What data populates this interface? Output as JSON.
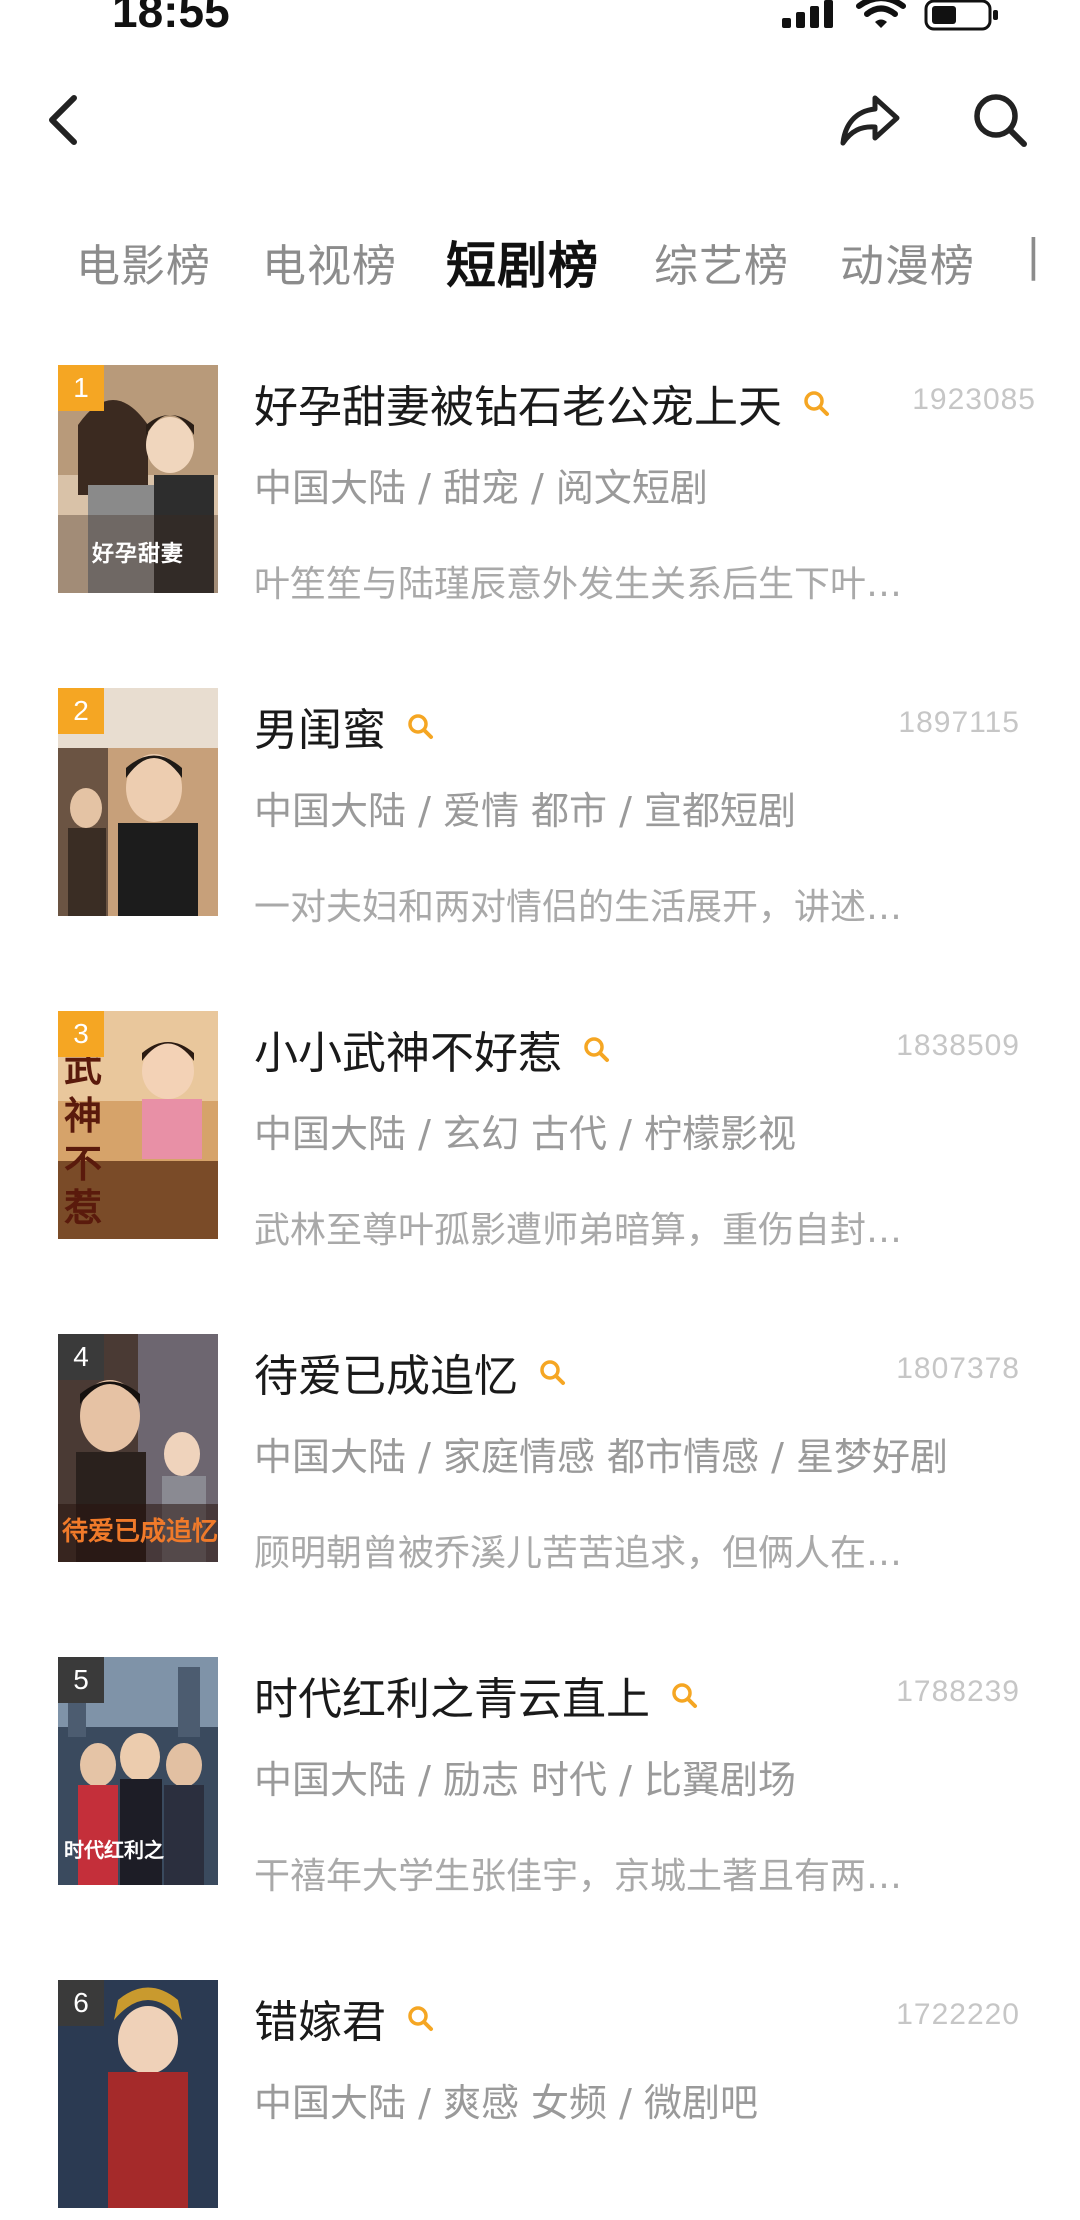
{
  "status_bar": {
    "time": "18:55"
  },
  "nav": {
    "back_icon": "chevron-left-icon",
    "share_icon": "share-arrow-icon",
    "search_icon": "search-icon"
  },
  "tabs": [
    {
      "label": "电影榜",
      "active": false
    },
    {
      "label": "电视榜",
      "active": false
    },
    {
      "label": "短剧榜",
      "active": true
    },
    {
      "label": "综艺榜",
      "active": false
    },
    {
      "label": "动漫榜",
      "active": false
    }
  ],
  "colors": {
    "accent": "#f5a623",
    "badge_top": "#f5a623",
    "badge_other": "#3a3a3a",
    "score": "#c6c6c6",
    "meta": "#9a9a9a"
  },
  "items": [
    {
      "rank": "1",
      "title": "好孕甜妻被钻石老公宠上天",
      "score": "1923085",
      "meta": "中国大陆 / 甜宠 / 阅文短剧",
      "desc": "叶笙笙与陆瑾辰意外发生关系后生下叶…"
    },
    {
      "rank": "2",
      "title": "男闺蜜",
      "score": "1897115",
      "meta": "中国大陆 / 爱情 都市 / 宣都短剧",
      "desc": "一对夫妇和两对情侣的生活展开，讲述…"
    },
    {
      "rank": "3",
      "title": "小小武神不好惹",
      "score": "1838509",
      "meta": "中国大陆 / 玄幻 古代 / 柠檬影视",
      "desc": "武林至尊叶孤影遭师弟暗算，重伤自封…"
    },
    {
      "rank": "4",
      "title": "待爱已成追忆",
      "score": "1807378",
      "meta": "中国大陆 / 家庭情感 都市情感 / 星梦好剧",
      "desc": "顾明朝曾被乔溪儿苦苦追求，但俩人在…"
    },
    {
      "rank": "5",
      "title": "时代红利之青云直上",
      "score": "1788239",
      "meta": "中国大陆 / 励志 时代 / 比翼剧场",
      "desc": "干禧年大学生张佳宇，京城土著且有两…"
    },
    {
      "rank": "6",
      "title": "错嫁君",
      "score": "1722220",
      "meta": "中国大陆 / 爽感 女频 / 微剧吧",
      "desc": ""
    }
  ]
}
